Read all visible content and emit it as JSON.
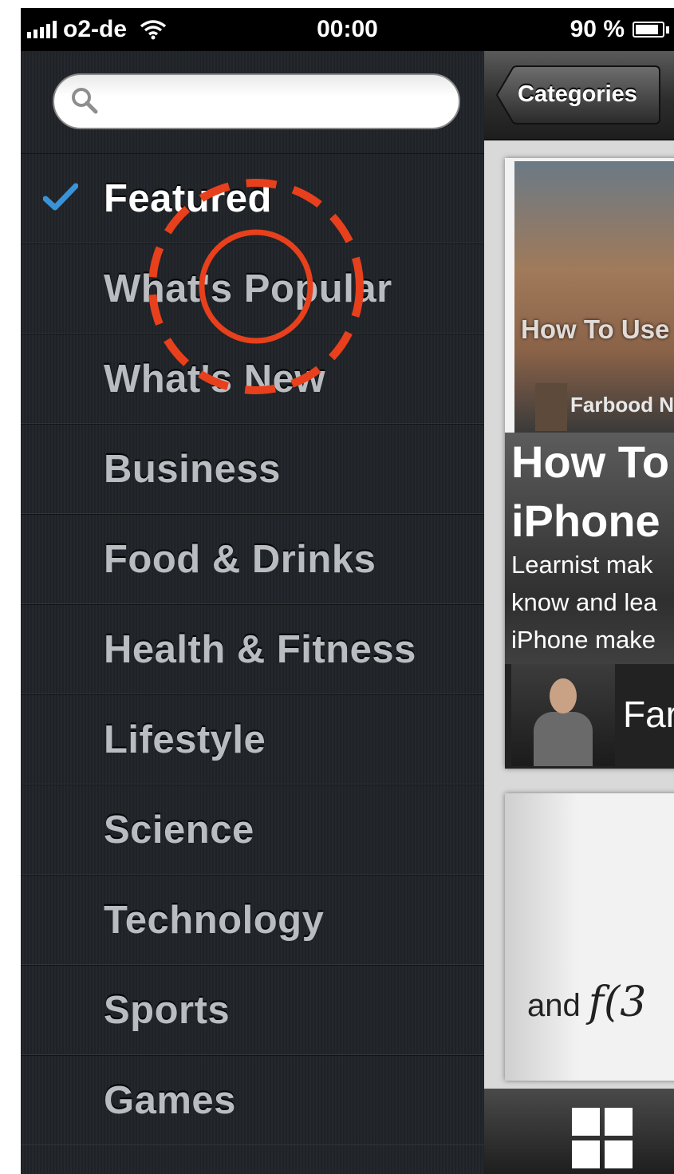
{
  "status_bar": {
    "carrier": "o2-de",
    "time": "00:00",
    "battery_percent": "90 %",
    "icons": [
      "signal-bars-icon",
      "wifi-icon",
      "battery-icon"
    ]
  },
  "menu": {
    "search": {
      "value": "",
      "placeholder": ""
    },
    "selected_index": 0,
    "items": [
      {
        "label": "Featured"
      },
      {
        "label": "What's Popular"
      },
      {
        "label": "What's New"
      },
      {
        "label": "Business"
      },
      {
        "label": "Food & Drinks"
      },
      {
        "label": "Health & Fitness"
      },
      {
        "label": "Lifestyle"
      },
      {
        "label": "Science"
      },
      {
        "label": "Technology"
      },
      {
        "label": "Sports"
      },
      {
        "label": "Games"
      }
    ]
  },
  "content": {
    "back_button": "Categories",
    "card": {
      "image_title": "How To Use Learnist",
      "image_author": "Farbood N",
      "title_line1": "How To",
      "title_line2": "iPhone",
      "desc_line1": "Learnist mak",
      "desc_line2": "know and lea",
      "desc_line3": "iPhone make",
      "author": "Far"
    },
    "card2": {
      "formula_word": "and",
      "formula": "f(3"
    },
    "tab_icon": "grid-icon"
  },
  "colors": {
    "touch_indicator": "#e8401c",
    "checkmark": "#3a93d6",
    "menu_text": "#b9bcc0",
    "menu_active_text": "#ffffff"
  }
}
